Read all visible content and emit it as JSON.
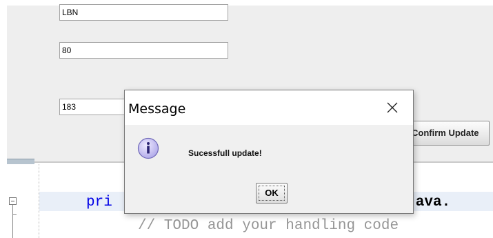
{
  "form": {
    "field1_value": "LBN",
    "field2_value": "80",
    "field3_value": "183",
    "confirm_button_label": "Confirm Update"
  },
  "editor": {
    "line1_keyword": "pri",
    "line1_right": "d(java.",
    "line2_comment": "// TODO add your handling code"
  },
  "dialog": {
    "title": "Message",
    "close_icon": "close-icon",
    "info_icon": "info-icon",
    "message": "Sucessfull update!",
    "ok_label": "OK"
  },
  "colors": {
    "keyword": "#0000e6",
    "comment": "#969696",
    "info_icon_fill": "#c7c3ee"
  }
}
